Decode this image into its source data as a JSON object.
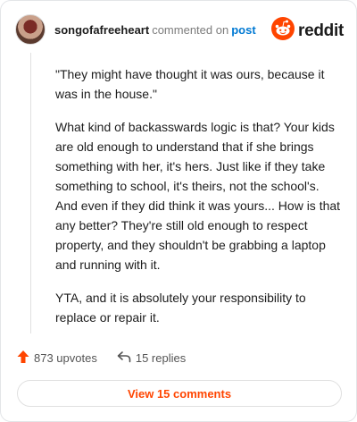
{
  "header": {
    "username": "songofafreeheart",
    "action": "commented on",
    "link_text": "post",
    "brand": "reddit"
  },
  "comment": {
    "paragraphs": [
      "\"They might have thought it was ours, because it was in the house.\"",
      "What kind of backasswards logic is that? Your kids are old enough to understand that if she brings something with her, it's hers. Just like if they take something to school, it's theirs, not the school's. And even if they did think it was yours... How is that any better? They're still old enough to respect property, and they shouldn't be grabbing a laptop and running with it.",
      "YTA, and it is absolutely your responsibility to replace or repair it."
    ]
  },
  "footer": {
    "upvotes": "873 upvotes",
    "replies": "15 replies",
    "view_button": "View 15 comments"
  },
  "colors": {
    "accent": "#ff4500",
    "link": "#0079d3"
  },
  "icons": [
    "reddit-logo-icon",
    "upvote-icon",
    "reply-icon"
  ]
}
